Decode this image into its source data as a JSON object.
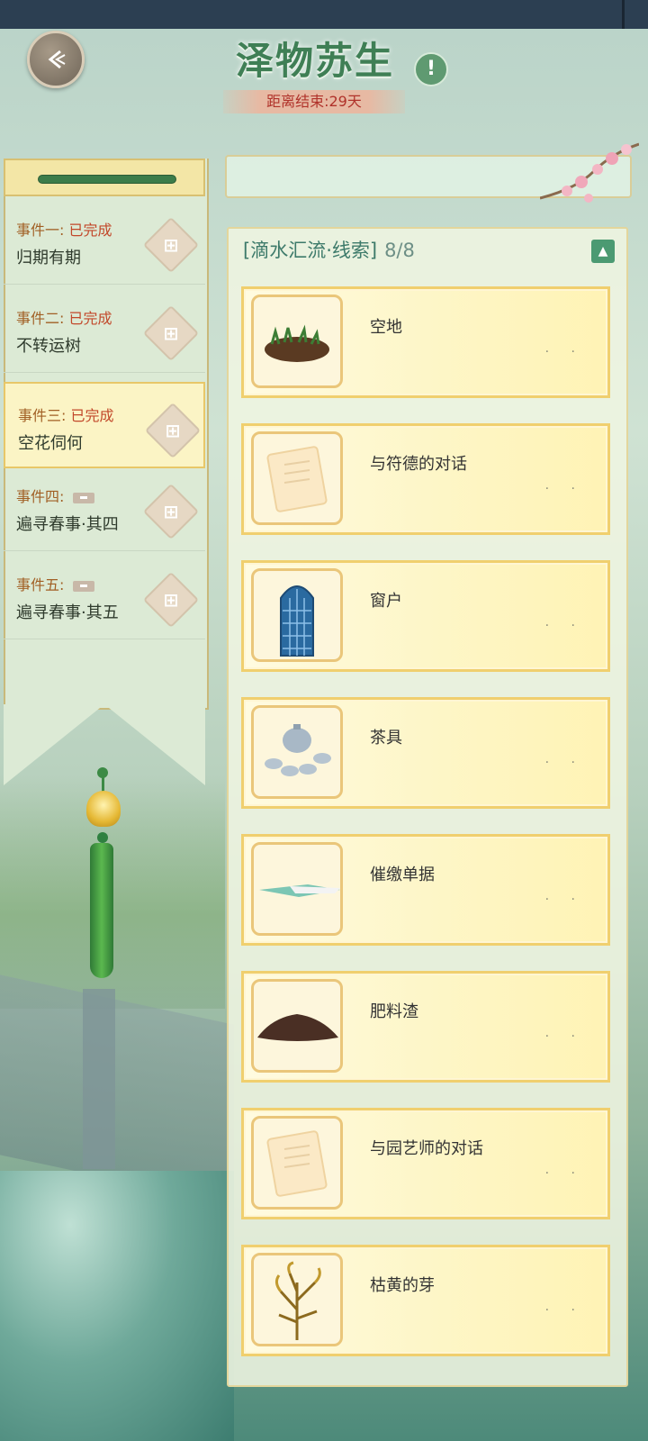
{
  "header": {
    "title": "泽物苏生",
    "countdown": "距离结束:29天",
    "info_label": "!"
  },
  "events": [
    {
      "label": "事件一:",
      "status": "已完成",
      "name": "归期有期",
      "locked": false,
      "selected": false
    },
    {
      "label": "事件二:",
      "status": "已完成",
      "name": "不转运树",
      "locked": false,
      "selected": false
    },
    {
      "label": "事件三:",
      "status": "已完成",
      "name": "空花伺何",
      "locked": false,
      "selected": true
    },
    {
      "label": "事件四:",
      "status": "",
      "name": "遍寻春事·其四",
      "locked": true,
      "selected": false
    },
    {
      "label": "事件五:",
      "status": "",
      "name": "遍寻春事·其五",
      "locked": true,
      "selected": false
    }
  ],
  "clues": {
    "title": "[滴水汇流·线索]",
    "progress": "8/8",
    "collapse_icon": "▲",
    "items": [
      {
        "name": "空地",
        "icon": "dirt-patch-icon"
      },
      {
        "name": "与符德的对话",
        "icon": "letter-icon"
      },
      {
        "name": "窗户",
        "icon": "window-icon"
      },
      {
        "name": "茶具",
        "icon": "tea-set-icon"
      },
      {
        "name": "催缴单据",
        "icon": "receipt-icon"
      },
      {
        "name": "肥料渣",
        "icon": "fertilizer-icon"
      },
      {
        "name": "与园艺师的对话",
        "icon": "letter-icon"
      },
      {
        "name": "枯黄的芽",
        "icon": "withered-sprout-icon"
      }
    ],
    "dots": "· ·"
  },
  "colors": {
    "accent_green": "#3f7f55",
    "completed_red": "#c2482a",
    "card_border": "#f0cf6e"
  }
}
